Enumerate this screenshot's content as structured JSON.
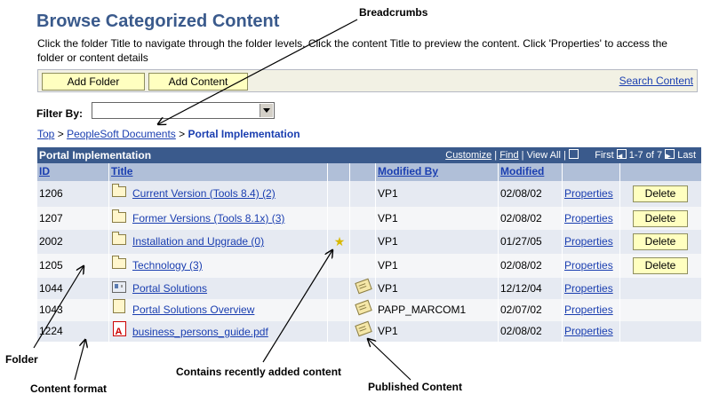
{
  "header": {
    "title": "Browse Categorized Content",
    "instructions": "Click the folder Title to navigate through the folder levels.  Click the content Title to preview the content.  Click 'Properties' to access the folder or content details"
  },
  "toolbar": {
    "add_folder": "Add Folder",
    "add_content": "Add Content",
    "search_content": "Search Content"
  },
  "filter": {
    "label": "Filter By:",
    "value": ""
  },
  "breadcrumb": {
    "items": [
      "Top",
      "PeopleSoft Documents"
    ],
    "separator": ">",
    "current": "Portal Implementation"
  },
  "grid": {
    "title": "Portal Implementation",
    "customize": "Customize",
    "find": "Find",
    "view_all": "View All",
    "first": "First",
    "range": "1-7 of 7",
    "last": "Last",
    "columns": {
      "id": "ID",
      "title": "Title",
      "modified_by": "Modified By",
      "modified": "Modified"
    },
    "properties_label": "Properties",
    "delete_label": "Delete",
    "rows": [
      {
        "id": "1206",
        "icon": "folder-icon",
        "title": "Current Version (Tools 8.4) (2)",
        "new": false,
        "published": false,
        "modified_by": "VP1",
        "modified": "02/08/02",
        "deletable": true
      },
      {
        "id": "1207",
        "icon": "folder-icon",
        "title": "Former Versions (Tools 8.1x) (3)",
        "new": false,
        "published": false,
        "modified_by": "VP1",
        "modified": "02/08/02",
        "deletable": true
      },
      {
        "id": "2002",
        "icon": "folder-icon",
        "title": "Installation and Upgrade (0)",
        "new": true,
        "published": false,
        "modified_by": "VP1",
        "modified": "01/27/05",
        "deletable": true
      },
      {
        "id": "1205",
        "icon": "folder-icon",
        "title": "Technology (3)",
        "new": false,
        "published": false,
        "modified_by": "VP1",
        "modified": "02/08/02",
        "deletable": true
      },
      {
        "id": "1044",
        "icon": "web-content-icon",
        "title": "Portal Solutions",
        "new": false,
        "published": true,
        "modified_by": "VP1",
        "modified": "12/12/04",
        "deletable": false
      },
      {
        "id": "1043",
        "icon": "document-icon",
        "title": "Portal Solutions Overview",
        "new": false,
        "published": true,
        "modified_by": "PAPP_MARCOM1",
        "modified": "02/07/02",
        "deletable": false
      },
      {
        "id": "1224",
        "icon": "pdf-icon",
        "title": "business_persons_guide.pdf",
        "new": false,
        "published": true,
        "modified_by": "VP1",
        "modified": "02/08/02",
        "deletable": false
      }
    ]
  },
  "annotations": {
    "breadcrumbs": "Breadcrumbs",
    "folder": "Folder",
    "content_format": "Content format",
    "recently_added": "Contains recently added content",
    "published": "Published Content"
  },
  "colors": {
    "header_bar": "#3a5a8c",
    "column_header": "#b0bfd8",
    "row_odd": "#e6eaf2",
    "row_even": "#f5f6f8",
    "button_fill": "#ffffc0",
    "link": "#1a3eb0"
  }
}
